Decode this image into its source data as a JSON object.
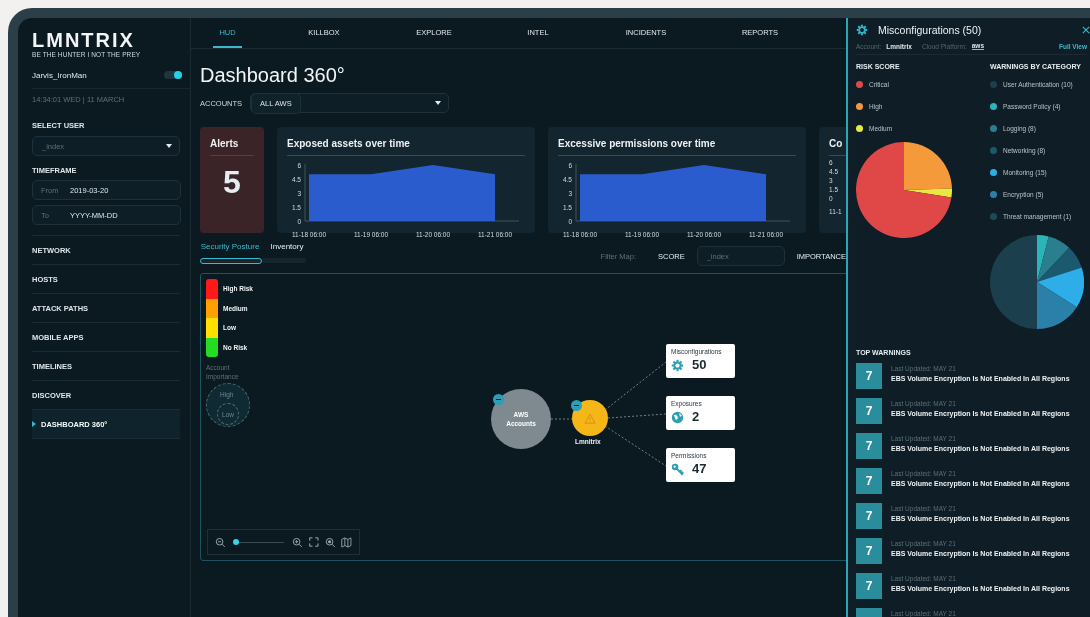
{
  "sidebar": {
    "logo": "LMNTRIX",
    "tagline": "BE THE HUNTER I NOT THE PREY",
    "user": {
      "name": "Jarvis_IronMan",
      "toggle_on": true
    },
    "datetime": "14:34:01 WED | 11 MARCH",
    "select_user": {
      "label": "SELECT USER",
      "placeholder": "_index"
    },
    "timeframe": {
      "label": "TIMEFRAME",
      "from": {
        "label": "From",
        "value": "2019-03-20"
      },
      "to": {
        "label": "To",
        "placeholder": "YYYY-MM-DD"
      }
    },
    "items": [
      {
        "label": "NETWORK",
        "selected": false
      },
      {
        "label": "HOSTS",
        "selected": false
      },
      {
        "label": "ATTACK PATHS",
        "selected": false
      },
      {
        "label": "MOBILE APPS",
        "selected": false
      },
      {
        "label": "TIMELINES",
        "selected": false
      },
      {
        "label": "DISCOVER",
        "selected": false
      },
      {
        "label": "DASHBOARD 360°",
        "selected": true
      }
    ]
  },
  "nav": {
    "tabs": [
      {
        "label": "HUD",
        "selected": true
      },
      {
        "label": "KILLBOX",
        "selected": false
      },
      {
        "label": "EXPLORE",
        "selected": false
      },
      {
        "label": "INTEL",
        "selected": false
      },
      {
        "label": "INCIDENTS",
        "selected": false
      },
      {
        "label": "REPORTS",
        "selected": false
      }
    ]
  },
  "page": {
    "title": "Dashboard 360°",
    "accounts": {
      "label": "ACCOUNTS",
      "chip": "ALL AWS"
    }
  },
  "cards": [
    {
      "kind": "alerts",
      "title": "Alerts",
      "value": "5"
    },
    {
      "kind": "chart",
      "title": "Exposed assets over time",
      "chart_data": {
        "type": "area",
        "categories": [
          "11-18 06:00",
          "11-19 06:00",
          "11-20 06:00",
          "11-21 06:00"
        ],
        "series": [
          {
            "color": "#2f63e0",
            "values": [
              5,
              5,
              6,
              5
            ]
          }
        ],
        "ylim": [
          0,
          6
        ],
        "yticks": [
          0,
          1.5,
          3,
          4.5,
          6
        ]
      }
    },
    {
      "kind": "chart",
      "title": "Excessive permissions over time",
      "chart_data": {
        "type": "area",
        "categories": [
          "11-18 06:00",
          "11-19 06:00",
          "11-20 06:00",
          "11-21 06:00"
        ],
        "series": [
          {
            "color": "#2f63e0",
            "values": [
              5,
              5,
              6,
              5
            ]
          }
        ],
        "ylim": [
          0,
          6
        ],
        "yticks": [
          0,
          1.5,
          3,
          4.5,
          6
        ]
      }
    },
    {
      "kind": "partial",
      "title": "Co",
      "ticks": [
        "6",
        "4.5",
        "3",
        "1.5",
        "0"
      ],
      "x_label": "11-1"
    }
  ],
  "posture": {
    "tabs": [
      {
        "label": "Security Posture",
        "selected": true
      },
      {
        "label": "Inventory",
        "selected": false
      }
    ],
    "filter": {
      "label": "Filter Map:",
      "score_label": "SCORE",
      "score_placeholder": "_index",
      "importance_label": "IMPORTANCE"
    }
  },
  "map": {
    "legend": [
      {
        "label": "High Risk",
        "color": "#ff1a1a"
      },
      {
        "label": "Medium",
        "color": "#ffa000"
      },
      {
        "label": "Low",
        "color": "#ffe000"
      },
      {
        "label": "No Risk",
        "color": "#22dd22"
      }
    ],
    "importance": {
      "title": "Account Importance",
      "high": "High",
      "low": "Low"
    },
    "nodes": [
      {
        "kind": "account",
        "label": "AWS Accounts",
        "collapsible": true
      },
      {
        "kind": "org",
        "label": "Lmnitrix",
        "collapsible": true
      }
    ],
    "findings": [
      {
        "kind": "misconfig",
        "title": "Misconfigurations",
        "count": "50"
      },
      {
        "kind": "exposure",
        "title": "Exposures",
        "count": "2"
      },
      {
        "kind": "permission",
        "title": "Permissions",
        "count": "47"
      }
    ],
    "zoom": {
      "level": 0.05
    }
  },
  "panel": {
    "title": "Misconfigurations (50)",
    "account_label": "Account:",
    "account": "Lmnitrix",
    "platform_label": "Cloud Platform:",
    "platform": "aws",
    "full_view": "Full View",
    "risk": {
      "title": "RISK SCORE",
      "items": [
        {
          "label": "Critical",
          "color": "#e04848"
        },
        {
          "label": "High",
          "color": "#f59a3a"
        },
        {
          "label": "Medium",
          "color": "#e8e840"
        }
      ]
    },
    "categories": {
      "title": "WARNINGS BY CATEGORY",
      "items": [
        {
          "label": "User Authentication (10)",
          "color": "#1b3f4c"
        },
        {
          "label": "Password Policy (4)",
          "color": "#2bb5b8"
        },
        {
          "label": "Logging (8)",
          "color": "#2a7f8e"
        },
        {
          "label": "Networking (8)",
          "color": "#1b5a6e"
        },
        {
          "label": "Monitoring (15)",
          "color": "#2eaee8"
        },
        {
          "label": "Encryption (5)",
          "color": "#2a80a8"
        },
        {
          "label": "Threat management (1)",
          "color": "#1d4a5a"
        }
      ]
    },
    "top": {
      "title": "TOP WARNINGS",
      "items": [
        {
          "score": "7",
          "updated": "Last Updated: MAY 21",
          "title": "EBS Volume Encryption Is Not Enabled In All Regions"
        },
        {
          "score": "7",
          "updated": "Last Updated: MAY 21",
          "title": "EBS Volume Encryption Is Not Enabled In All Regions"
        },
        {
          "score": "7",
          "updated": "Last Updated: MAY 21",
          "title": "EBS Volume Encryption Is Not Enabled In All Regions"
        },
        {
          "score": "7",
          "updated": "Last Updated: MAY 21",
          "title": "EBS Volume Encryption Is Not Enabled In All Regions"
        },
        {
          "score": "7",
          "updated": "Last Updated: MAY 21",
          "title": "EBS Volume Encryption Is Not Enabled In All Regions"
        },
        {
          "score": "7",
          "updated": "Last Updated: MAY 21",
          "title": "EBS Volume Encryption Is Not Enabled In All Regions"
        },
        {
          "score": "7",
          "updated": "Last Updated: MAY 21",
          "title": "EBS Volume Encryption Is Not Enabled In All Regions"
        },
        {
          "updated": "Last Updated: MAY 21"
        }
      ]
    }
  }
}
